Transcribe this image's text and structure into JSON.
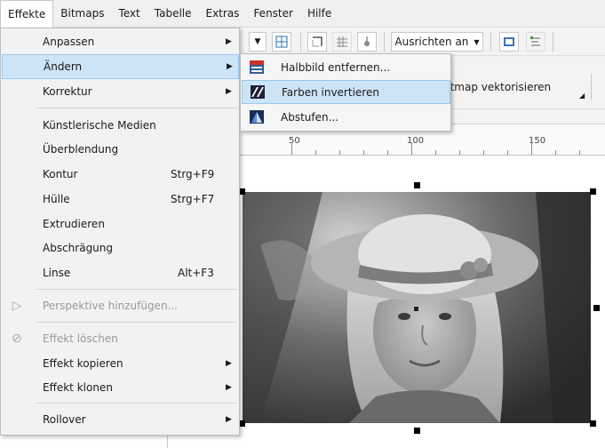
{
  "menubar": {
    "items": [
      {
        "label": "Effekte",
        "name": "menu-effekte",
        "active": true
      },
      {
        "label": "Bitmaps",
        "name": "menu-bitmaps"
      },
      {
        "label": "Text",
        "name": "menu-text"
      },
      {
        "label": "Tabelle",
        "name": "menu-tabelle"
      },
      {
        "label": "Extras",
        "name": "menu-extras"
      },
      {
        "label": "Fenster",
        "name": "menu-fenster"
      },
      {
        "label": "Hilfe",
        "name": "menu-hilfe"
      }
    ]
  },
  "toolbar": {
    "ausrichten_label": "Ausrichten an",
    "bitmap_vectorize_label": "Bitmap vektorisieren"
  },
  "ruler": {
    "labels": [
      "50",
      "100",
      "150"
    ]
  },
  "effekte_menu": {
    "items": [
      {
        "label": "Anpassen",
        "submenu": true
      },
      {
        "label": "Ändern",
        "submenu": true,
        "highlighted": true
      },
      {
        "label": "Korrektur",
        "submenu": true
      },
      {
        "label": "Künstlerische Medien"
      },
      {
        "label": "Überblendung"
      },
      {
        "label": "Kontur",
        "shortcut": "Strg+F9"
      },
      {
        "label": "Hülle",
        "shortcut": "Strg+F7"
      },
      {
        "label": "Extrudieren"
      },
      {
        "label": "Abschrägung"
      },
      {
        "label": "Linse",
        "shortcut": "Alt+F3"
      },
      {
        "label": "Perspektive hinzufügen...",
        "disabled": true
      },
      {
        "label": "Effekt löschen",
        "disabled": true
      },
      {
        "label": "Effekt kopieren",
        "submenu": true
      },
      {
        "label": "Effekt klonen",
        "submenu": true
      },
      {
        "label": "Rollover",
        "submenu": true
      }
    ]
  },
  "aendern_submenu": {
    "items": [
      {
        "label": "Halbbild entfernen...",
        "icon": "halftone-remove-icon"
      },
      {
        "label": "Farben invertieren",
        "icon": "invert-colors-icon",
        "highlighted": true
      },
      {
        "label": "Abstufen...",
        "icon": "posterize-icon"
      }
    ]
  },
  "colors": {
    "highlight": "#cde4f7",
    "menu_bg": "#f2f2f2"
  }
}
